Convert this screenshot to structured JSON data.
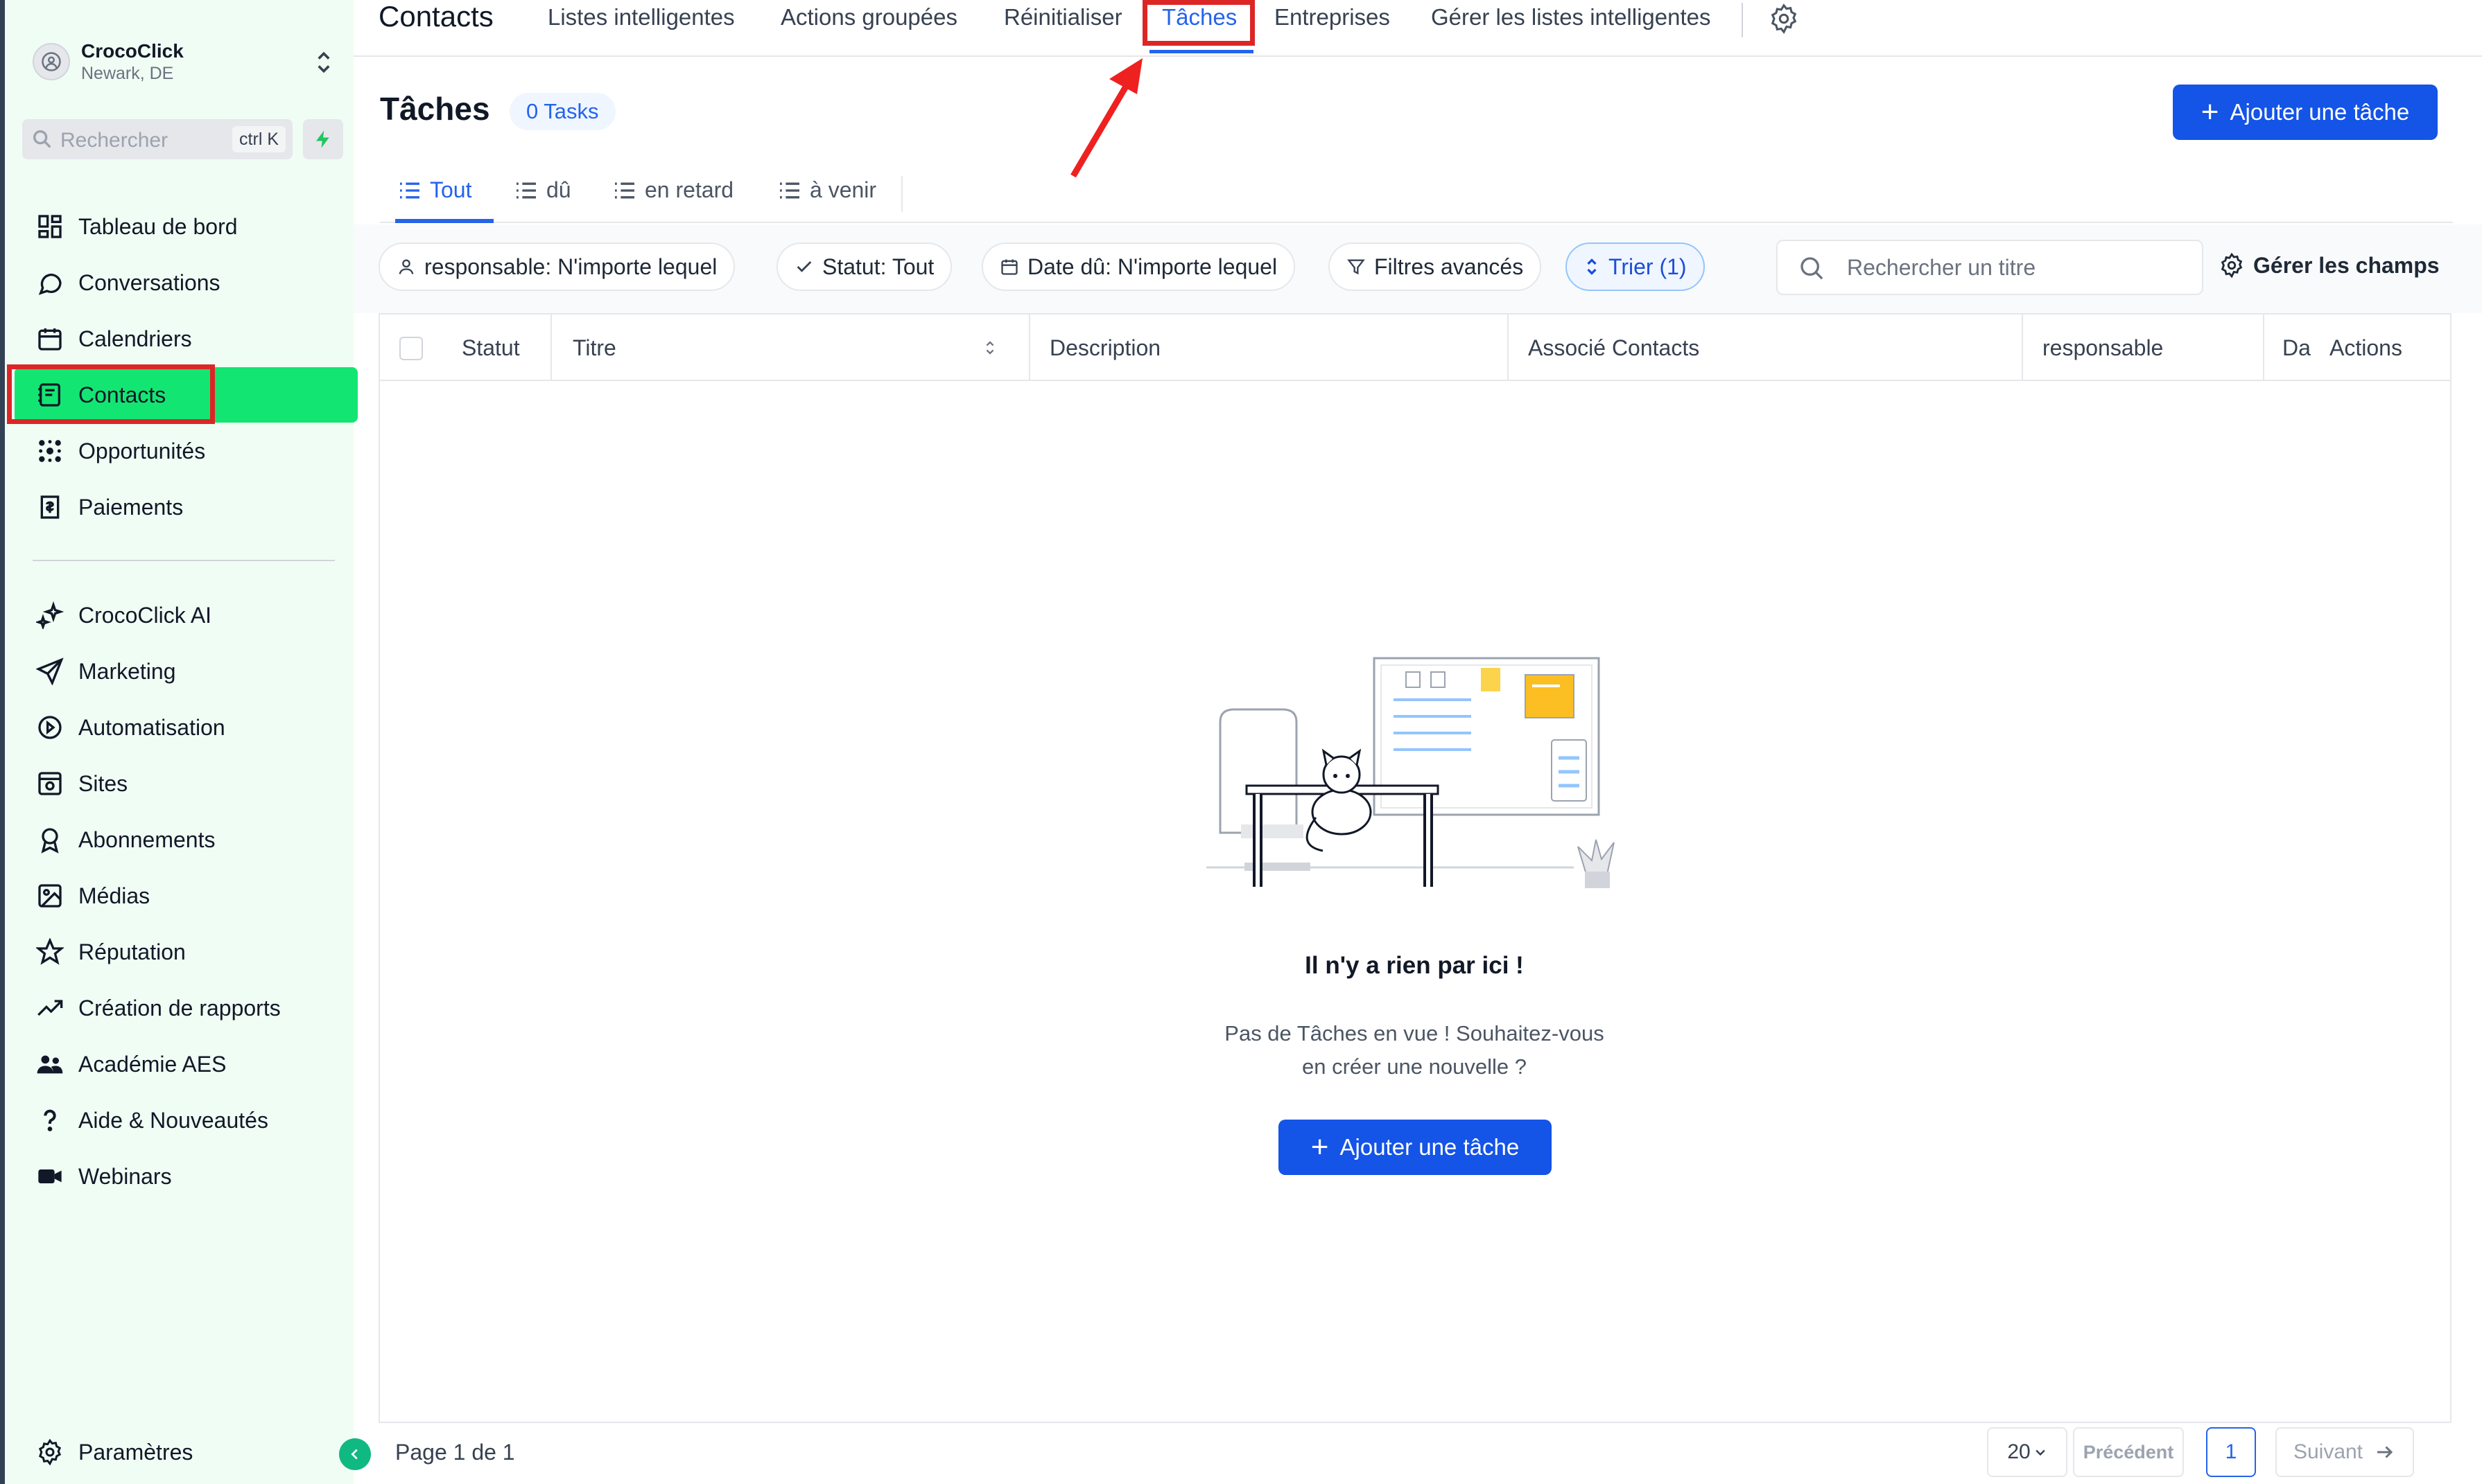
{
  "account": {
    "name": "CrocoClick",
    "location": "Newark, DE"
  },
  "sidebar_search": {
    "placeholder": "Rechercher",
    "shortcut": "ctrl K"
  },
  "sidebar": {
    "items": [
      {
        "label": "Tableau de bord",
        "icon": "dashboard-icon"
      },
      {
        "label": "Conversations",
        "icon": "chat-icon"
      },
      {
        "label": "Calendriers",
        "icon": "calendar-icon"
      },
      {
        "label": "Contacts",
        "icon": "contacts-icon",
        "active": true
      },
      {
        "label": "Opportunités",
        "icon": "opportunities-icon"
      },
      {
        "label": "Paiements",
        "icon": "payments-icon"
      }
    ],
    "items2": [
      {
        "label": "CrocoClick AI",
        "icon": "sparkle-icon"
      },
      {
        "label": "Marketing",
        "icon": "send-icon"
      },
      {
        "label": "Automatisation",
        "icon": "automation-icon"
      },
      {
        "label": "Sites",
        "icon": "sites-icon"
      },
      {
        "label": "Abonnements",
        "icon": "badge-icon"
      },
      {
        "label": "Médias",
        "icon": "image-icon"
      },
      {
        "label": "Réputation",
        "icon": "star-icon"
      },
      {
        "label": "Création de rapports",
        "icon": "trend-icon"
      },
      {
        "label": "Académie AES",
        "icon": "users-icon"
      },
      {
        "label": "Aide & Nouveautés",
        "icon": "question-icon"
      },
      {
        "label": "Webinars",
        "icon": "video-icon"
      }
    ],
    "settings": "Paramètres"
  },
  "topnav": {
    "title": "Contacts",
    "links": [
      "Listes intelligentes",
      "Actions groupées",
      "Réinitialiser",
      "Tâches",
      "Entreprises",
      "Gérer les listes intelligentes"
    ],
    "active": "Tâches"
  },
  "page": {
    "title": "Tâches",
    "count": "0 Tasks",
    "add_button": "Ajouter une tâche"
  },
  "subtabs": [
    "Tout",
    "dû",
    "en retard",
    "à venir"
  ],
  "filters": {
    "assignee": "responsable: N'importe lequel",
    "status": "Statut: Tout",
    "due": "Date dû: N'importe lequel",
    "advanced": "Filtres avancés",
    "sort": "Trier (1)",
    "search_placeholder": "Rechercher un titre",
    "manage_fields": "Gérer les champs"
  },
  "table": {
    "columns": [
      "Statut",
      "Titre",
      "Description",
      "Associé Contacts",
      "responsable",
      "Da",
      "Actions"
    ]
  },
  "empty": {
    "title": "Il n'y a rien par ici !",
    "line1": "Pas de Tâches en vue ! Souhaitez-vous",
    "line2": "en créer une nouvelle ?",
    "button": "Ajouter une tâche"
  },
  "pagination": {
    "label": "Page 1 de 1",
    "per_page": "20",
    "prev": "Précédent",
    "current": "1",
    "next": "Suivant"
  },
  "colors": {
    "accent": "#1454e6",
    "active_nav": "#13e573",
    "highlight": "#dc2626",
    "sidebar_bg": "#f0fdf4"
  }
}
